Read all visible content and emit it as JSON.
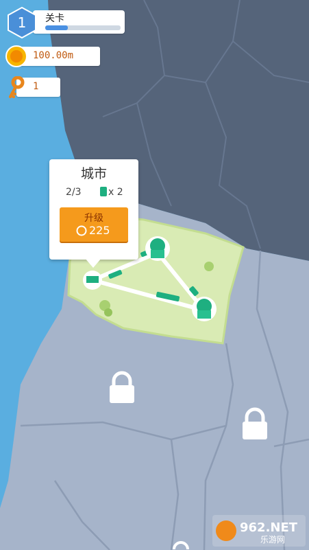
{
  "hud": {
    "level": {
      "number": "1",
      "label": "关卡",
      "progress": 0.3
    },
    "coins": {
      "value": "100.00m",
      "icon": "coin-icon"
    },
    "keys": {
      "value": "1",
      "icon": "key-icon"
    }
  },
  "popup": {
    "title": "城市",
    "stations": "2/3",
    "train_multiplier": "x 2",
    "upgrade": {
      "label": "升级",
      "cost": "225"
    }
  },
  "watermark": {
    "big": "962.NET",
    "small": "乐游网"
  },
  "colors": {
    "sea": "#5aaee0",
    "land_dark": "#55647a",
    "land_locked": "#a6b4ca",
    "land_active": "#d9ebb4",
    "track": "#1eaf80",
    "accent_orange": "#f59a1c",
    "level_badge": "#4a8fd8"
  }
}
